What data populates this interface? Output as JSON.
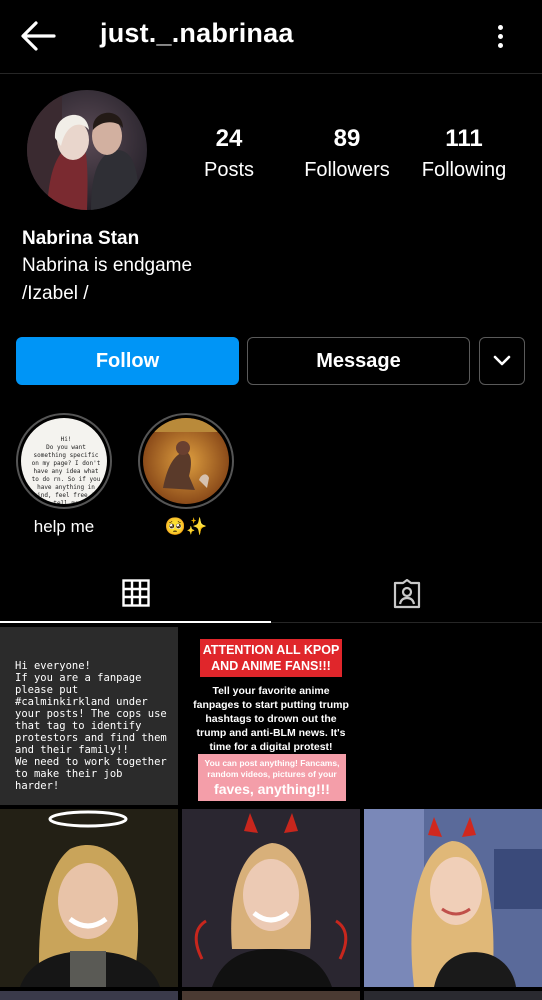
{
  "header": {
    "username": "just._.nabrinaa"
  },
  "stats": [
    {
      "value": "24",
      "label": "Posts"
    },
    {
      "value": "89",
      "label": "Followers"
    },
    {
      "value": "111",
      "label": "Following"
    }
  ],
  "bio": {
    "name": "Nabrina Stan",
    "lines": [
      "Nabrina is endgame",
      "/Izabel /"
    ]
  },
  "actions": {
    "follow": "Follow",
    "message": "Message"
  },
  "highlights": [
    {
      "caption": "help me",
      "cover_text": "Hi!\nDo you want something specific on my page? I don't have any idea what to do rn. So if you have anything in mind, feel free to tell me"
    },
    {
      "caption": "🥺✨"
    }
  ],
  "posts": {
    "text_post": "Hi everyone!\nIf you are a fanpage please put #calminkirkland under your posts! The cops use that tag to identify protestors and find them and their family!!\nWe need to work together to make their job harder!",
    "poster": {
      "banner": "ATTENTION ALL KPOP AND ANIME FANS!!!",
      "body": "Tell your favorite anime fanpages to start putting trump hashtags to drown out the trump and anti-BLM news. It's time for a digital protest!",
      "pink_small": "You can post anything! Fancams, random videos, pictures of your",
      "pink_big": "faves, anything!!!"
    }
  },
  "colors": {
    "follow_button": "#0095f6",
    "background": "#000000",
    "poster_banner": "#e0262b",
    "poster_pink": "#f49ea9"
  }
}
